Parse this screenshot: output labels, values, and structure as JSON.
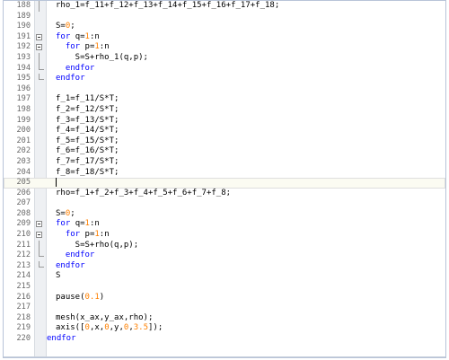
{
  "editor": {
    "lines": [
      {
        "n": "188",
        "fold": "line",
        "segs": [
          {
            "t": "rho_1=f_11+f_12+f_13+f_14+f_15+f_16+f_17+f_18;",
            "c": ""
          }
        ]
      },
      {
        "n": "189",
        "fold": "",
        "segs": []
      },
      {
        "n": "190",
        "fold": "",
        "segs": [
          {
            "t": "S=",
            "c": ""
          },
          {
            "t": "0",
            "c": "num"
          },
          {
            "t": ";",
            "c": ""
          }
        ]
      },
      {
        "n": "191",
        "fold": "box",
        "segs": [
          {
            "t": "for ",
            "c": "kw"
          },
          {
            "t": "q=",
            "c": ""
          },
          {
            "t": "1",
            "c": "num"
          },
          {
            "t": ":n",
            "c": ""
          }
        ]
      },
      {
        "n": "192",
        "fold": "box",
        "segs": [
          {
            "t": "  ",
            "c": ""
          },
          {
            "t": "for ",
            "c": "kw"
          },
          {
            "t": "p=",
            "c": ""
          },
          {
            "t": "1",
            "c": "num"
          },
          {
            "t": ":n",
            "c": ""
          }
        ]
      },
      {
        "n": "193",
        "fold": "line",
        "segs": [
          {
            "t": "    S=S+rho_1(q,p);",
            "c": ""
          }
        ]
      },
      {
        "n": "194",
        "fold": "end",
        "segs": [
          {
            "t": "  ",
            "c": ""
          },
          {
            "t": "endfor",
            "c": "kw"
          }
        ]
      },
      {
        "n": "195",
        "fold": "end",
        "segs": [
          {
            "t": "endfor",
            "c": "kw"
          }
        ]
      },
      {
        "n": "196",
        "fold": "",
        "segs": []
      },
      {
        "n": "197",
        "fold": "",
        "segs": [
          {
            "t": "f_1=f_11/S*T;",
            "c": ""
          }
        ]
      },
      {
        "n": "198",
        "fold": "",
        "segs": [
          {
            "t": "f_2=f_12/S*T;",
            "c": ""
          }
        ]
      },
      {
        "n": "199",
        "fold": "",
        "segs": [
          {
            "t": "f_3=f_13/S*T;",
            "c": ""
          }
        ]
      },
      {
        "n": "200",
        "fold": "",
        "segs": [
          {
            "t": "f_4=f_14/S*T;",
            "c": ""
          }
        ]
      },
      {
        "n": "201",
        "fold": "",
        "segs": [
          {
            "t": "f_5=f_15/S*T;",
            "c": ""
          }
        ]
      },
      {
        "n": "202",
        "fold": "",
        "segs": [
          {
            "t": "f_6=f_16/S*T;",
            "c": ""
          }
        ]
      },
      {
        "n": "203",
        "fold": "",
        "segs": [
          {
            "t": "f_7=f_17/S*T;",
            "c": ""
          }
        ]
      },
      {
        "n": "204",
        "fold": "",
        "segs": [
          {
            "t": "f_8=f_18/S*T;",
            "c": ""
          }
        ]
      },
      {
        "n": "205",
        "fold": "",
        "current": true,
        "segs": []
      },
      {
        "n": "206",
        "fold": "",
        "segs": [
          {
            "t": "rho=f_1+f_2+f_3+f_4+f_5+f_6+f_7+f_8;",
            "c": ""
          }
        ]
      },
      {
        "n": "207",
        "fold": "",
        "segs": []
      },
      {
        "n": "208",
        "fold": "",
        "segs": [
          {
            "t": "S=",
            "c": ""
          },
          {
            "t": "0",
            "c": "num"
          },
          {
            "t": ";",
            "c": ""
          }
        ]
      },
      {
        "n": "209",
        "fold": "box",
        "segs": [
          {
            "t": "for ",
            "c": "kw"
          },
          {
            "t": "q=",
            "c": ""
          },
          {
            "t": "1",
            "c": "num"
          },
          {
            "t": ":n",
            "c": ""
          }
        ]
      },
      {
        "n": "210",
        "fold": "box",
        "segs": [
          {
            "t": "  ",
            "c": ""
          },
          {
            "t": "for ",
            "c": "kw"
          },
          {
            "t": "p=",
            "c": ""
          },
          {
            "t": "1",
            "c": "num"
          },
          {
            "t": ":n",
            "c": ""
          }
        ]
      },
      {
        "n": "211",
        "fold": "line",
        "segs": [
          {
            "t": "    S=S+rho(q,p);",
            "c": ""
          }
        ]
      },
      {
        "n": "212",
        "fold": "end",
        "segs": [
          {
            "t": "  ",
            "c": ""
          },
          {
            "t": "endfor",
            "c": "kw"
          }
        ]
      },
      {
        "n": "213",
        "fold": "end",
        "segs": [
          {
            "t": "endfor",
            "c": "kw"
          }
        ]
      },
      {
        "n": "214",
        "fold": "",
        "segs": [
          {
            "t": "S",
            "c": ""
          }
        ]
      },
      {
        "n": "215",
        "fold": "",
        "segs": []
      },
      {
        "n": "216",
        "fold": "",
        "segs": [
          {
            "t": "pause(",
            "c": ""
          },
          {
            "t": "0.1",
            "c": "num"
          },
          {
            "t": ")",
            "c": ""
          }
        ]
      },
      {
        "n": "217",
        "fold": "",
        "segs": []
      },
      {
        "n": "218",
        "fold": "",
        "segs": [
          {
            "t": "mesh(x_ax,y_ax,rho);",
            "c": ""
          }
        ]
      },
      {
        "n": "219",
        "fold": "",
        "segs": [
          {
            "t": "axis([",
            "c": ""
          },
          {
            "t": "0",
            "c": "num"
          },
          {
            "t": ",x,",
            "c": ""
          },
          {
            "t": "0",
            "c": "num"
          },
          {
            "t": ",y,",
            "c": ""
          },
          {
            "t": "0",
            "c": "num"
          },
          {
            "t": ",",
            "c": ""
          },
          {
            "t": "3.5",
            "c": "num"
          },
          {
            "t": "]);",
            "c": ""
          }
        ]
      },
      {
        "n": "220",
        "fold": "",
        "segs": [
          {
            "t": "endfor",
            "c": "kw"
          }
        ],
        "unindented": true
      }
    ]
  }
}
